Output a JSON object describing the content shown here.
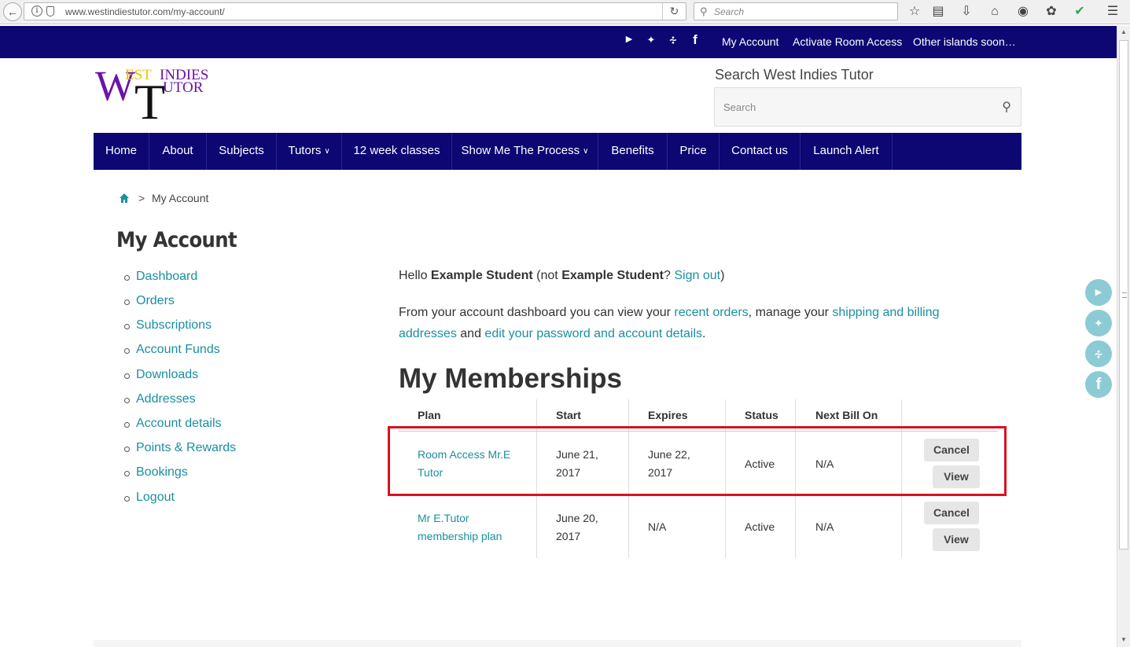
{
  "browser": {
    "url": "www.westindiestutor.com/my-account/",
    "search_placeholder": "Search"
  },
  "topbar": {
    "links": [
      "My Account",
      "Activate Room Access",
      "Other islands soon…"
    ]
  },
  "logo": {
    "letter_w": "W",
    "letter_t": "T",
    "est": "EST",
    "indies": "INDIES",
    "utor": "UTOR"
  },
  "header_search": {
    "title": "Search West Indies Tutor",
    "placeholder": "Search"
  },
  "nav": {
    "items": [
      {
        "label": "Home"
      },
      {
        "label": "About"
      },
      {
        "label": "Subjects"
      },
      {
        "label": "Tutors",
        "dropdown": true
      },
      {
        "label": "12 week classes"
      },
      {
        "label": "Show Me The Process",
        "dropdown": true
      },
      {
        "label": "Benefits"
      },
      {
        "label": "Price"
      },
      {
        "label": "Contact us"
      },
      {
        "label": "Launch Alert"
      }
    ]
  },
  "breadcrumb": {
    "separator": ">",
    "current": "My Account"
  },
  "sidebar": {
    "title": "My Account",
    "items": [
      "Dashboard",
      "Orders",
      "Subscriptions",
      "Account Funds",
      "Downloads",
      "Addresses",
      "Account details",
      "Points & Rewards",
      "Bookings",
      "Logout"
    ]
  },
  "content": {
    "hello_prefix": "Hello ",
    "user_name": "Example Student",
    "hello_not": " (not ",
    "user_name_2": "Example Student",
    "hello_q": "? ",
    "sign_out": "Sign out",
    "hello_close": ")",
    "intro_1": "From your account dashboard you can view your ",
    "link_orders": "recent orders",
    "intro_2": ", manage your ",
    "link_addresses": "shipping and billing addresses",
    "intro_3": " and ",
    "link_account": "edit your password and account details",
    "intro_4": "."
  },
  "memberships": {
    "title": "My Memberships",
    "headers": [
      "Plan",
      "Start",
      "Expires",
      "Status",
      "Next Bill On"
    ],
    "rows": [
      {
        "plan_line1": "Room Access Mr.E",
        "plan_line2": "Tutor",
        "start_line1": "June 21,",
        "start_line2": "2017",
        "expires_line1": "June 22,",
        "expires_line2": "2017",
        "status": "Active",
        "next_bill": "N/A",
        "cancel": "Cancel",
        "view": "View"
      },
      {
        "plan_line1": "Mr E.Tutor",
        "plan_line2": "membership plan",
        "start_line1": "June 20,",
        "start_line2": "2017",
        "expires_line1": "N/A",
        "expires_line2": "",
        "status": "Active",
        "next_bill": "N/A",
        "cancel": "Cancel",
        "view": "View"
      }
    ]
  },
  "colors": {
    "brand_navy": "#0c0773",
    "link_teal": "#1a8fa0",
    "highlight_red": "#d8121f",
    "social_float": "#8ccbd6"
  },
  "icons": {
    "social": [
      "youtube-icon",
      "twitter-icon",
      "rss-icon",
      "facebook-icon"
    ]
  }
}
